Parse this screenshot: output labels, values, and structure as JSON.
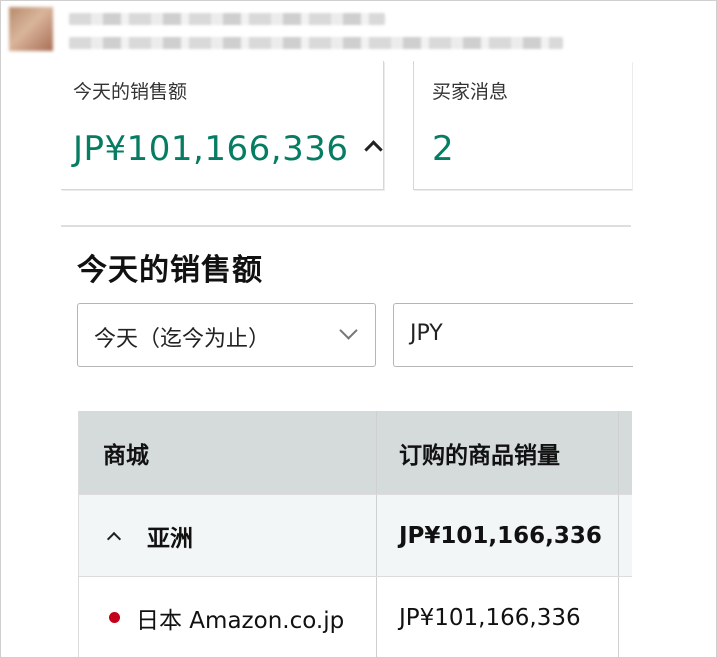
{
  "summary": {
    "sales_label": "今天的销售额",
    "sales_value": "JP¥101,166,336",
    "messages_label": "买家消息",
    "messages_value": "2"
  },
  "section": {
    "title": "今天的销售额"
  },
  "filters": {
    "period": "今天（迄今为止）",
    "currency": "JPY"
  },
  "table": {
    "columns": [
      "商城",
      "订购的商品销量"
    ],
    "rows": [
      {
        "type": "group",
        "marketplace": "亚洲",
        "sales": "JP¥101,166,336",
        "expanded": true
      },
      {
        "type": "item",
        "marketplace": "日本 Amazon.co.jp",
        "sales": "JP¥101,166,336",
        "dot_color": "#c40018"
      }
    ]
  },
  "colors": {
    "accent": "#067d62",
    "header_bg": "#d5dbdb",
    "marker_red": "#c40018"
  }
}
